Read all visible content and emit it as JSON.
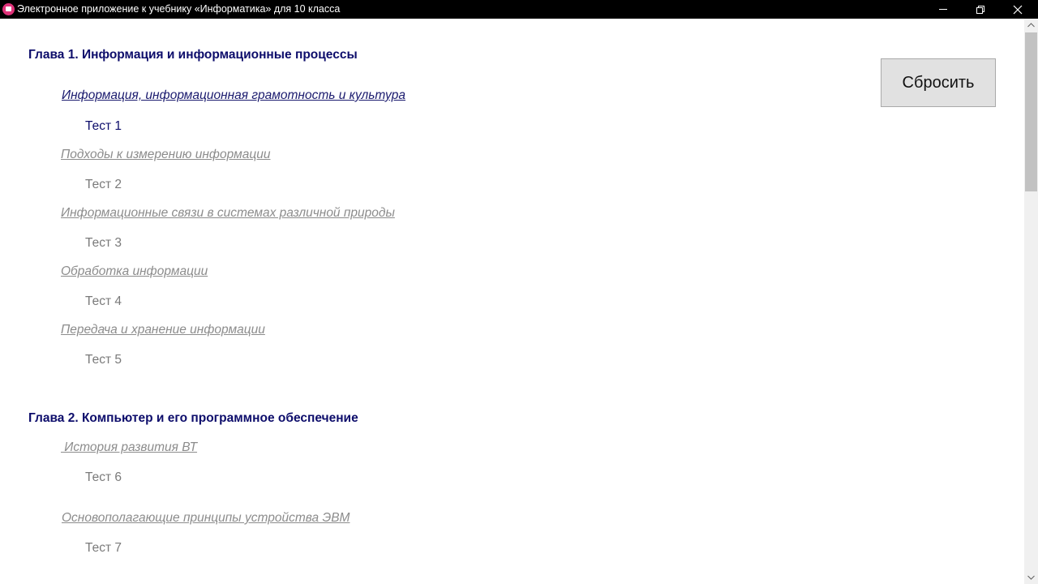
{
  "window": {
    "title": "Электронное приложение к учебнику «Информатика» для 10 класса",
    "app_icon": "book-icon",
    "titlebar_color": "#000000"
  },
  "reset_button": {
    "label": "Сбросить"
  },
  "chapter1": {
    "title": "Глава 1. Информация и информационные процессы",
    "items": [
      {
        "lesson": "Информация, информационная грамотность и культура",
        "test": "Тест 1"
      },
      {
        "lesson": "Подходы к измерению информации",
        "test": "Тест 2"
      },
      {
        "lesson": "Информационные связи в системах различной природы",
        "test": "Тест 3"
      },
      {
        "lesson": "Обработка информации",
        "test": "Тест 4"
      },
      {
        "lesson": "Передача и хранение информации",
        "test": "Тест 5"
      }
    ]
  },
  "chapter2": {
    "title": "Глава 2. Компьютер и его программное обеспечение",
    "items": [
      {
        "lesson": " История развития ВТ",
        "test": "Тест 6"
      },
      {
        "lesson": "Основополагающие принципы устройства ЭВМ",
        "test": "Тест 7"
      }
    ]
  },
  "colors": {
    "chapter": "#0d0d6b",
    "lesson_active": "#1a1a6e",
    "lesson_inactive": "#8c8c8c",
    "test_inactive": "#7a7a7a"
  }
}
